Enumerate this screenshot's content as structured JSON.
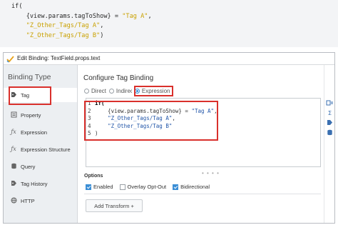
{
  "snippet": {
    "line1": "if(",
    "line2_pre": "    {view.params.tagToShow} = ",
    "line2_str": "\"Tag A\"",
    "line2_post": ",",
    "line3_str": "\"Z_Other_Tags/Tag A\"",
    "line3_post": ",",
    "line4_str": "\"Z_Other_Tags/Tag B\"",
    "line4_post": ")"
  },
  "dialog": {
    "title": "Edit Binding: TextField.props.text"
  },
  "sidebar": {
    "heading": "Binding Type",
    "items": [
      {
        "label": "Tag",
        "icon": "tag-icon"
      },
      {
        "label": "Property",
        "icon": "property-icon"
      },
      {
        "label": "Expression",
        "icon": "fx-icon"
      },
      {
        "label": "Expression Structure",
        "icon": "fx-icon"
      },
      {
        "label": "Query",
        "icon": "database-icon"
      },
      {
        "label": "Tag History",
        "icon": "history-icon"
      },
      {
        "label": "HTTP",
        "icon": "globe-icon"
      }
    ],
    "selected": "Tag"
  },
  "main": {
    "heading": "Configure Tag Binding",
    "modes": [
      "Direct",
      "Indirect",
      "Expression"
    ],
    "selected_mode": "Expression",
    "code_lines": [
      {
        "n": "1",
        "text": "if("
      },
      {
        "n": "2",
        "pre": "    {view.params.tagToShow} = ",
        "str": "\"Tag A\"",
        "post": ","
      },
      {
        "n": "3",
        "pre": "    ",
        "str": "\"Z_Other_Tags/Tag A\"",
        "post": ","
      },
      {
        "n": "4",
        "pre": "    ",
        "str": "\"Z_Other_Tags/Tag B\"",
        "post": ""
      },
      {
        "n": "5",
        "text": ")"
      }
    ],
    "options_label": "Options",
    "checkboxes": [
      {
        "label": "Enabled",
        "checked": true
      },
      {
        "label": "Overlay Opt-Out",
        "checked": false
      },
      {
        "label": "Bidirectional",
        "checked": true
      }
    ],
    "add_transform_label": "Add Transform +"
  },
  "rightbar": {
    "icons": [
      "insert-property-icon",
      "sigma-icon",
      "tag-icon",
      "database-icon"
    ]
  },
  "colors": {
    "highlight": "#d9302c",
    "accent": "#3b8ed6",
    "snippet_string": "#c9a100"
  }
}
